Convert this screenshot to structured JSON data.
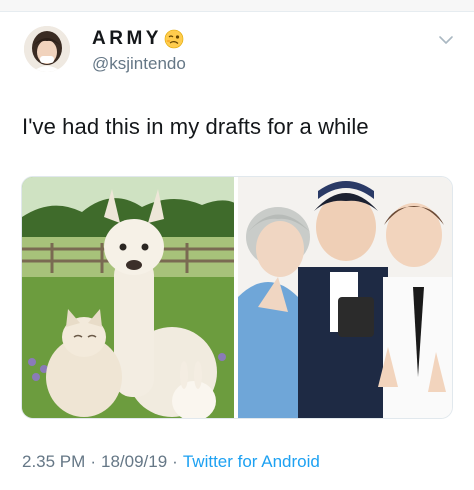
{
  "user": {
    "display_name": "ARMY",
    "handle": "@ksjintendo",
    "avatar_icon": "profile-photo",
    "name_emoji_icon": "woozy-face-emoji"
  },
  "tweet": {
    "text": "I've had this in my drafts for a while",
    "media": [
      {
        "icon": "alpaca-cat-rabbit-photo"
      },
      {
        "icon": "three-people-photo"
      }
    ]
  },
  "meta": {
    "time": "2.35 PM",
    "separator": "·",
    "date": "18/09/19",
    "source": "Twitter for Android"
  },
  "colors": {
    "text": "#14171a",
    "secondary": "#657786",
    "link": "#1da1f2"
  }
}
